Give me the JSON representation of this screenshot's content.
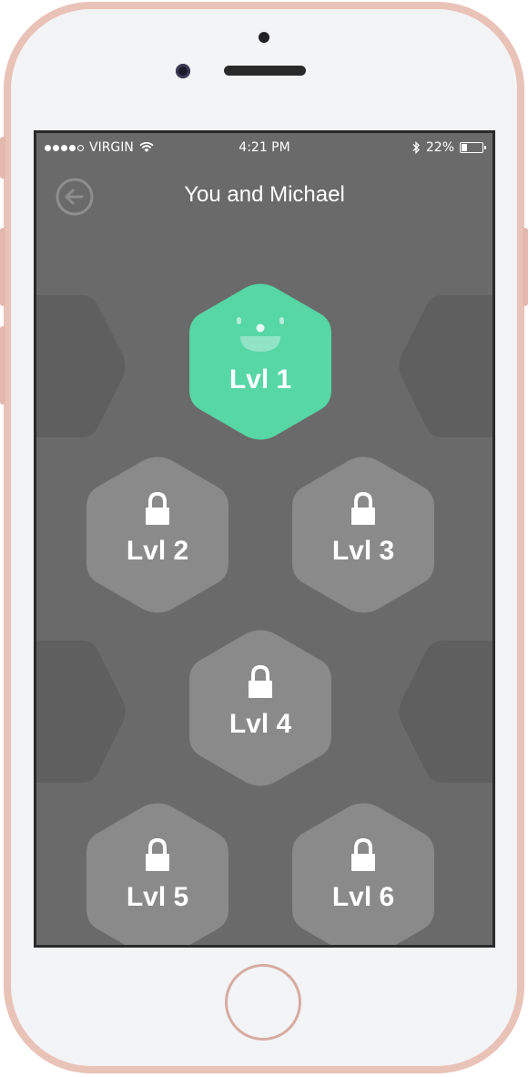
{
  "status_bar": {
    "carrier": "VIRGIN",
    "time": "4:21 PM",
    "battery": "22%",
    "battery_level": 0.22,
    "signal_bars_filled": 4,
    "signal_bars_total": 5
  },
  "header": {
    "title": "You and Michael",
    "back_icon": "arrow-left-circle-icon"
  },
  "levels": [
    {
      "label": "Lvl 1",
      "state": "unlocked",
      "icon": "smiley-face-icon"
    },
    {
      "label": "Lvl 2",
      "state": "locked",
      "icon": "lock-icon"
    },
    {
      "label": "Lvl 3",
      "state": "locked",
      "icon": "lock-icon"
    },
    {
      "label": "Lvl 4",
      "state": "locked",
      "icon": "lock-icon"
    },
    {
      "label": "Lvl 5",
      "state": "locked",
      "icon": "lock-icon"
    },
    {
      "label": "Lvl 6",
      "state": "locked",
      "icon": "lock-icon"
    }
  ],
  "colors": {
    "unlocked": "#57d6a6",
    "locked": "#8a8a8a",
    "background": "#6a6a6a",
    "ghost": "#5f5f5f"
  }
}
